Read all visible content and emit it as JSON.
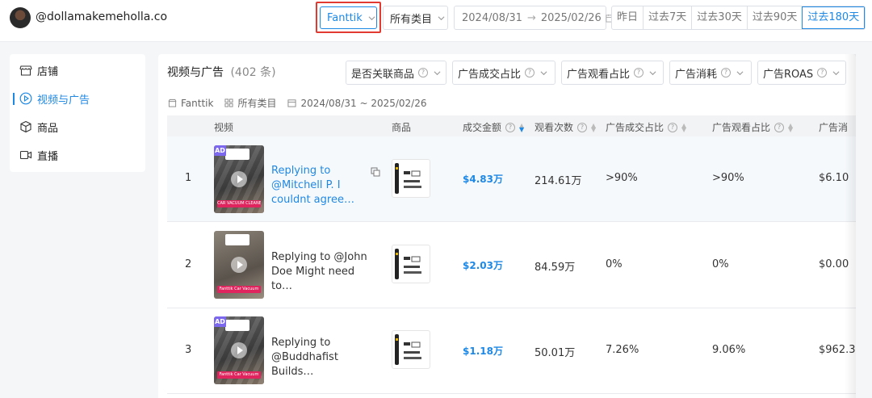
{
  "header": {
    "handle": "@dollamakemeholla.co",
    "shop_select": "Fanttik",
    "category_select": "所有类目",
    "date_start": "2024/08/31",
    "date_arrow": "→",
    "date_end": "2025/02/26",
    "ranges": [
      "昨日",
      "过去7天",
      "过去30天",
      "过去90天",
      "过去180天"
    ],
    "active_range": "过去180天"
  },
  "sidebar": {
    "items": [
      {
        "label": "店铺",
        "icon": "store-icon"
      },
      {
        "label": "视频与广告",
        "icon": "play-circle-icon",
        "active": true
      },
      {
        "label": "商品",
        "icon": "box-icon"
      },
      {
        "label": "直播",
        "icon": "video-camera-icon"
      }
    ]
  },
  "main": {
    "title": "视频与广告",
    "count": "(402 条)",
    "filters": [
      "是否关联商品",
      "广告成交占比",
      "广告观看占比",
      "广告消耗",
      "广告ROAS"
    ],
    "meta": {
      "shop": "Fanttik",
      "category": "所有类目",
      "date_range": "2024/08/31 ~ 2025/02/26"
    },
    "columns": [
      "视频",
      "商品",
      "成交金额",
      "观看次数",
      "广告成交占比",
      "广告观看占比",
      "广告消"
    ],
    "rows": [
      {
        "rank": "1",
        "title": "Replying to @Mitchell P. I couldnt agree…",
        "ad": "AD",
        "caption": "CAR VACUUM CLEANER",
        "gmv": "$4.83万",
        "views": "214.61万",
        "ad_gmv_ratio": ">90%",
        "ad_view_ratio": ">90%",
        "ad_spend": "$6.10"
      },
      {
        "rank": "2",
        "title": "Replying to @John Doe Might need to…",
        "ad": "",
        "caption": "Fanttik Car Vacuum",
        "gmv": "$2.03万",
        "views": "84.59万",
        "ad_gmv_ratio": "0%",
        "ad_view_ratio": "0%",
        "ad_spend": "$0.00"
      },
      {
        "rank": "3",
        "title": "Replying to @Buddhafist Builds…",
        "ad": "AD",
        "caption": "Fanttik Car Vacuum",
        "gmv": "$1.18万",
        "views": "50.01万",
        "ad_gmv_ratio": "7.26%",
        "ad_view_ratio": "9.06%",
        "ad_spend": "$962.3"
      }
    ]
  },
  "colors": {
    "accent": "#1e88e5",
    "highlight_box": "#e23a30",
    "ad_badge": "#7b68ee",
    "caption_bar": "#e0245e"
  }
}
